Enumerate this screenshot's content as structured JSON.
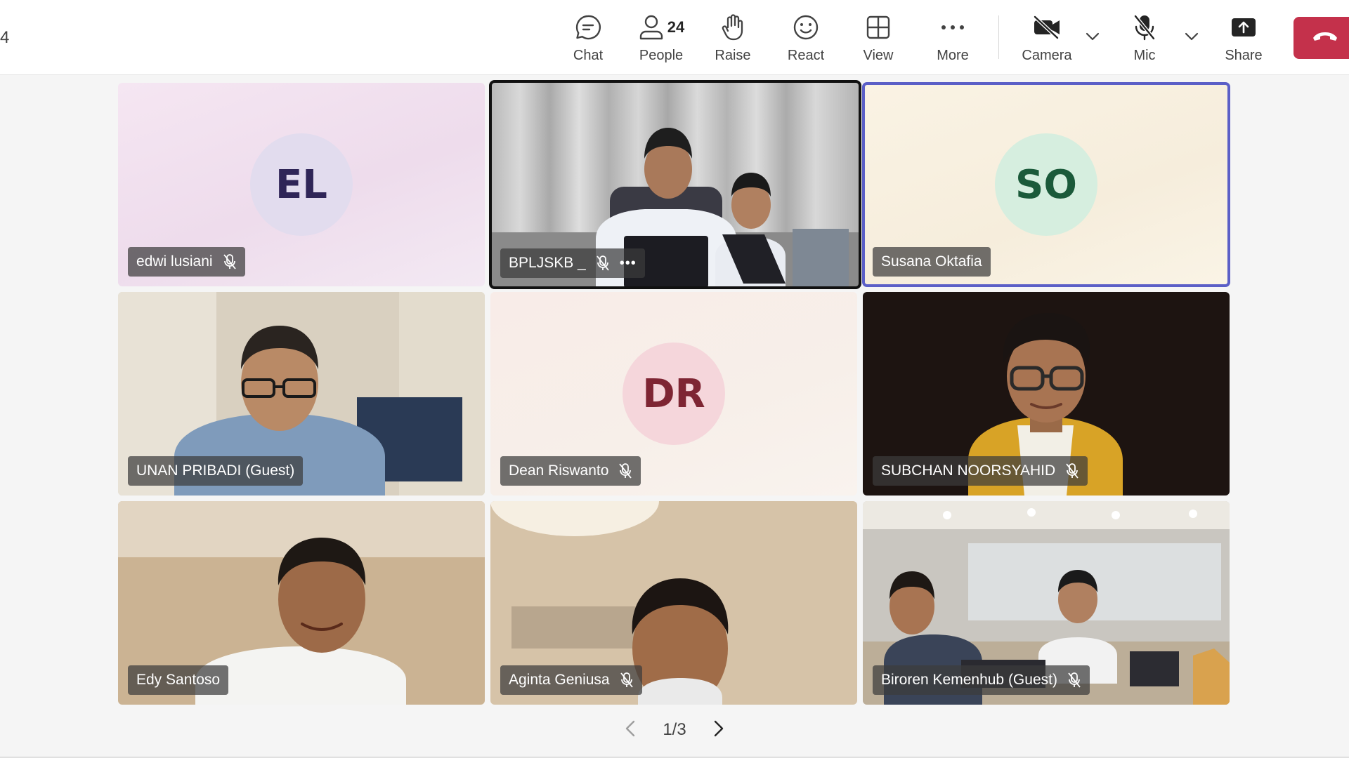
{
  "meeting": {
    "timer_fragment": "4"
  },
  "toolbar": {
    "chat_label": "Chat",
    "people_label": "People",
    "people_count": "24",
    "raise_label": "Raise",
    "react_label": "React",
    "view_label": "View",
    "more_label": "More",
    "camera_label": "Camera",
    "mic_label": "Mic",
    "share_label": "Share",
    "leave_color": "#c4314b"
  },
  "participants": [
    {
      "name": "edwi lusiani",
      "initials": "EL",
      "muted": true,
      "video": false,
      "avatar_bg": "#e5def0",
      "avatar_fg": "#3b2a5e"
    },
    {
      "name": "BPLJSKB _",
      "initials": "",
      "muted": true,
      "video": true,
      "speaking": true
    },
    {
      "name": "Susana Oktafia",
      "initials": "SO",
      "muted": false,
      "video": false,
      "avatar_bg": "#d7efe2",
      "avatar_fg": "#1f5c3d",
      "spotlight_color": "#5b5fc7"
    },
    {
      "name": "UNAN PRIBADI (Guest)",
      "initials": "",
      "muted": false,
      "video": true
    },
    {
      "name": "Dean Riswanto",
      "initials": "DR",
      "muted": true,
      "video": false,
      "avatar_bg": "#f6d9de",
      "avatar_fg": "#8a2a38"
    },
    {
      "name": "SUBCHAN NOORSYAHID",
      "initials": "",
      "muted": true,
      "video": true
    },
    {
      "name": "Edy Santoso",
      "initials": "",
      "muted": false,
      "video": true
    },
    {
      "name": "Aginta Geniusa",
      "initials": "",
      "muted": true,
      "video": true
    },
    {
      "name": "Biroren Kemenhub (Guest)",
      "initials": "",
      "muted": true,
      "video": true
    }
  ],
  "pager": {
    "text": "1/3"
  }
}
